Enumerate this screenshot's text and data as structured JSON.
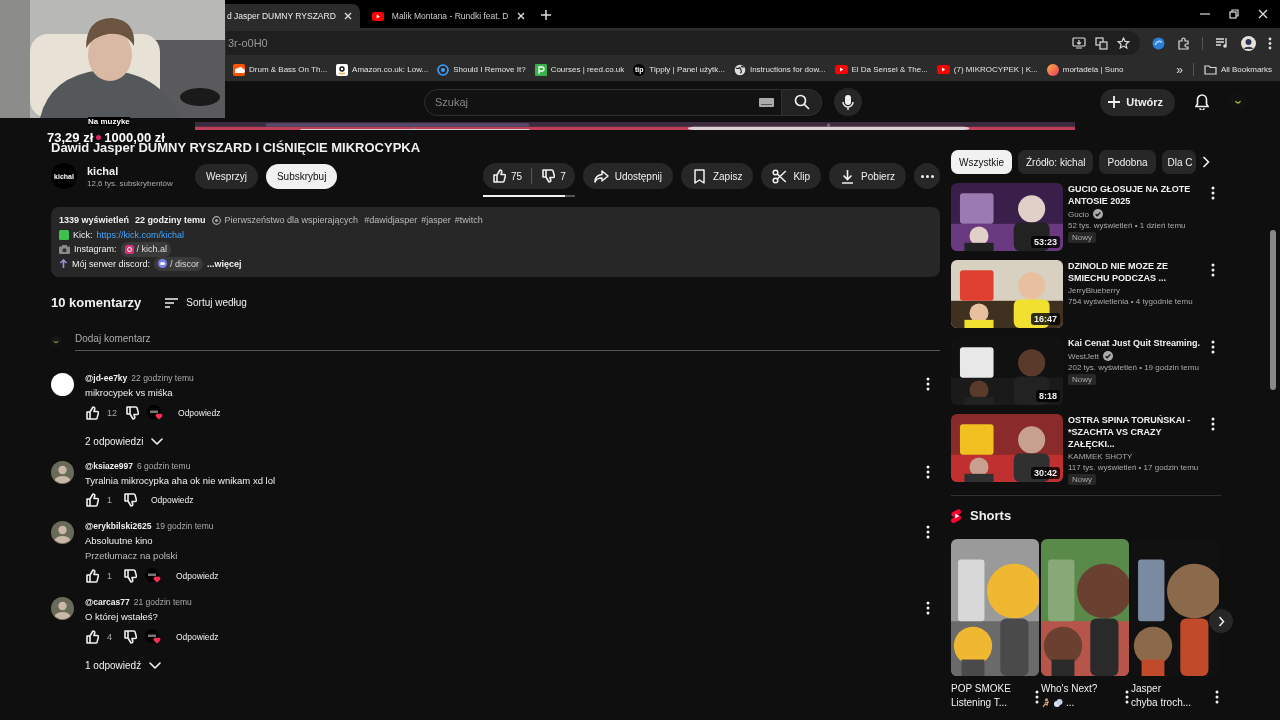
{
  "browser": {
    "tabs": [
      {
        "title": "d Jasper DUMNY RYSZARD",
        "selected": true
      },
      {
        "title": "Malik Montana - Rundki feat. D",
        "selected": false
      }
    ],
    "address": "3r-o0H0",
    "bookmarks": [
      {
        "kind": "soundcloud",
        "label": "Drum & Bass On Th..."
      },
      {
        "kind": "amazon",
        "label": "Amazon.co.uk: Low..."
      },
      {
        "kind": "ring",
        "label": "Should I Remove It?"
      },
      {
        "kind": "reed",
        "label": "Courses | reed.co.uk"
      },
      {
        "kind": "tip",
        "badge": "tip",
        "label": "Tipply | Panel użytk..."
      },
      {
        "kind": "globe",
        "label": "Instructions for dow..."
      },
      {
        "kind": "youtube",
        "label": "El Da Sensei & The..."
      },
      {
        "kind": "youtube",
        "label": "(7) MIKROCYPEK | K..."
      },
      {
        "kind": "suno",
        "label": "mortadela | Suno"
      }
    ],
    "more": "»",
    "all_bookmarks": "All Bookmarks"
  },
  "overlay": {
    "caption": "Na muzyke",
    "goal_raised": "73,29 zł",
    "goal_target": "1000,00 zł"
  },
  "masthead": {
    "search_placeholder": "Szukaj",
    "create": "Utwórz"
  },
  "video": {
    "title": "Dawid Jasper DUMNY RYSZARD I CIŚNIĘCIE MIKROCYPKA",
    "channel": {
      "avatar_text": "kichal",
      "name": "kichal",
      "subscribers": "12,6 tys. subskrybentów"
    },
    "support": "Wesprzyj",
    "subscribe": "Subskrybuj",
    "likes": "75",
    "dislikes": "7",
    "like_ratio": {
      "level": 0.89
    },
    "actions": [
      {
        "kind": "share",
        "label": "Udostępnij"
      },
      {
        "kind": "save",
        "label": "Zapisz"
      },
      {
        "kind": "clip",
        "label": "Klip"
      },
      {
        "kind": "download",
        "label": "Pobierz"
      }
    ],
    "description": {
      "views": "1339 wyświetleń",
      "date": "22 godziny temu",
      "members_first": "Pierwszeństwo dla wspierających",
      "tags": [
        "#dawidjasper",
        "#jasper",
        "#twitch"
      ],
      "lines": [
        {
          "kind": "kick",
          "label": "Kick:",
          "link": "https://kick.com/kichal"
        },
        {
          "kind": "instagram",
          "label": "Instagram:",
          "chip": "/ kich.al"
        },
        {
          "kind": "discord",
          "label": "Mój serwer discord:",
          "chip": "/ discor",
          "more": "...więcej"
        }
      ]
    }
  },
  "comments": {
    "count": "10 komentarzy",
    "sort": "Sortuj według",
    "add_placeholder": "Dodaj komentarz",
    "items": [
      {
        "kind": "blank",
        "author": "@jd-ee7ky",
        "time": "22 godziny temu",
        "text": "mikrocypek vs miśka",
        "likes": "12",
        "hearted": true,
        "reply": "Odpowiedz",
        "replies": "2 odpowiedzi"
      },
      {
        "author": "@ksiaze997",
        "time": "6 godzin temu",
        "text": "Tyralnia mikrocypka aha ok nie wnikam xd lol",
        "likes": "1",
        "hearted": false,
        "reply": "Odpowiedz"
      },
      {
        "author": "@erykbilski2625",
        "time": "19 godzin temu",
        "text": "Absoluutne kino",
        "translate": "Przetłumacz na polski",
        "likes": "1",
        "hearted": true,
        "reply": "Odpowiedz"
      },
      {
        "author": "@carcas77",
        "time": "21 godzin temu",
        "text": "O której wstałeś?",
        "likes": "4",
        "hearted": true,
        "reply": "Odpowiedz",
        "replies": "1 odpowiedź"
      }
    ]
  },
  "sidebar": {
    "chips": [
      {
        "label": "Wszystkie",
        "selected": true
      },
      {
        "label": "Źródło: kichal",
        "selected": false
      },
      {
        "label": "Podobna",
        "selected": false
      },
      {
        "label": "Dla C",
        "selected": false
      }
    ],
    "videos": [
      {
        "title": "GUCIO GŁOSUJE NA ZŁOTE ANTOSIE 2025",
        "channel": "Gucio",
        "verified": true,
        "meta": "52 tys. wyświetleń • 1 dzień temu",
        "badge": "Nowy",
        "duration": "53:23"
      },
      {
        "title": "DZINOLD NIE MOZE ZE SMIECHU PODCZAS ...",
        "channel": "JerryBlueberry",
        "verified": false,
        "meta": "754 wyświetlenia • 4 tygodnie temu",
        "duration": "16:47"
      },
      {
        "title": "Kai Cenat Just Quit Streaming.",
        "channel": "WestJett",
        "verified": true,
        "meta": "202 tys. wyświetleń • 19 godzin temu",
        "badge": "Nowy",
        "duration": "8:18"
      },
      {
        "title": "OSTRA SPINA TORUŃSKAI - *SZACHTA VS CRAZY ZAŁĘCKI...",
        "channel": "KAMMEK SHOTY",
        "verified": false,
        "meta": "117 tys. wyświetleń • 17 godzin temu",
        "badge": "Nowy",
        "duration": "30:42"
      }
    ],
    "shorts": {
      "title": "Shorts",
      "items": [
        {
          "lines": [
            "POP SMOKE",
            "Listening T..."
          ],
          "emojis": false
        },
        {
          "lines": [
            "Who's Next?",
            "..."
          ],
          "emojis": true
        },
        {
          "lines": [
            "Jasper",
            "chyba troch..."
          ],
          "emojis": false
        }
      ]
    }
  }
}
